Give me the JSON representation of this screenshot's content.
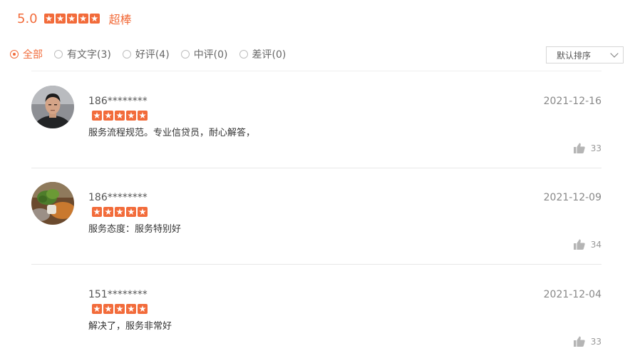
{
  "summary": {
    "score": "5.0",
    "rating_text": "超棒",
    "stars": 5
  },
  "filters": [
    {
      "label": "全部",
      "active": true
    },
    {
      "label": "有文字(3)",
      "active": false
    },
    {
      "label": "好评(4)",
      "active": false
    },
    {
      "label": "中评(0)",
      "active": false
    },
    {
      "label": "差评(0)",
      "active": false
    }
  ],
  "sort": {
    "selected": "默认排序"
  },
  "reviews": [
    {
      "user": "186********",
      "stars": 5,
      "text": "服务流程规范。专业信贷员，耐心解答，",
      "date": "2021-12-16",
      "likes": "33",
      "avatar": "photo-man"
    },
    {
      "user": "186********",
      "stars": 5,
      "text": "服务态度：服务特别好",
      "date": "2021-12-09",
      "likes": "34",
      "avatar": "photo-plant"
    },
    {
      "user": "151********",
      "stars": 5,
      "text": "解决了，服务非常好",
      "date": "2021-12-04",
      "likes": "33",
      "avatar": "none"
    }
  ],
  "colors": {
    "accent": "#f26b3a",
    "text": "#333333",
    "muted": "#888888"
  }
}
